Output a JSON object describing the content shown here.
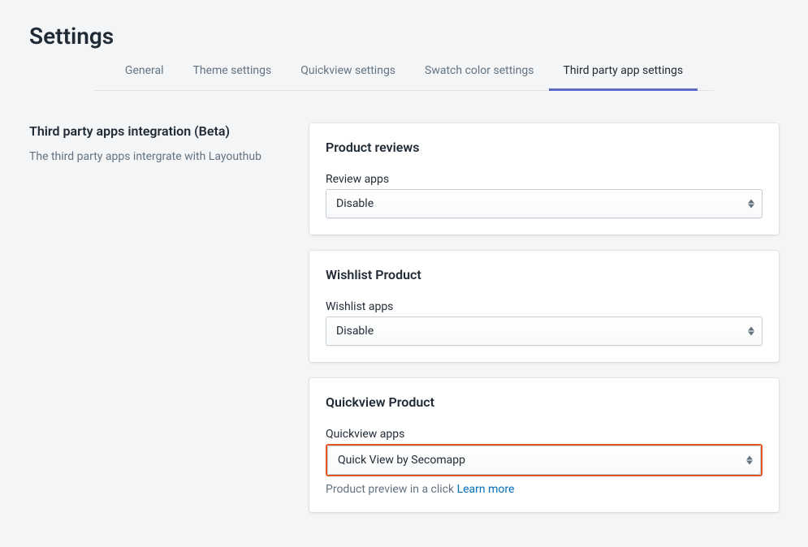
{
  "page": {
    "title": "Settings"
  },
  "tabs": {
    "items": [
      "General",
      "Theme settings",
      "Quickview settings",
      "Swatch color settings",
      "Third party app settings"
    ],
    "active_index": 4
  },
  "sidebar": {
    "heading": "Third party apps integration (Beta)",
    "description": "The third party apps intergrate with Layouthub"
  },
  "cards": {
    "reviews": {
      "title": "Product reviews",
      "field_label": "Review apps",
      "value": "Disable"
    },
    "wishlist": {
      "title": "Wishlist Product",
      "field_label": "Wishlist apps",
      "value": "Disable"
    },
    "quickview": {
      "title": "Quickview Product",
      "field_label": "Quickview apps",
      "value": "Quick View by Secomapp",
      "help_text": "Product preview in a click",
      "help_link": " Learn more"
    }
  }
}
